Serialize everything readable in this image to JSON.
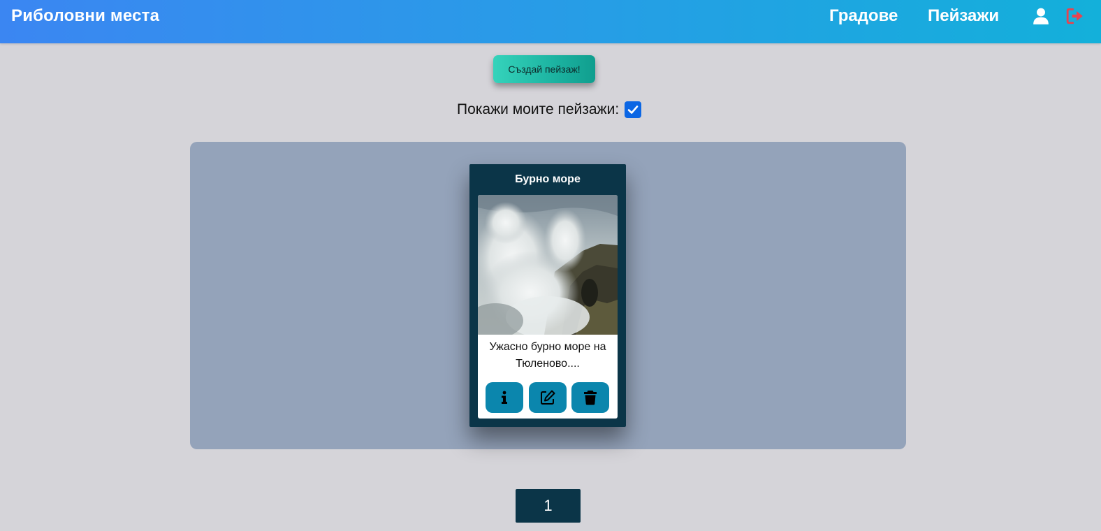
{
  "navbar": {
    "brand": "Риболовни места",
    "links": [
      {
        "label": "Градове"
      },
      {
        "label": "Пейзажи"
      }
    ],
    "icons": {
      "user": "user-icon",
      "logout": "logout-icon"
    },
    "colors": {
      "gradient_start": "#3b86f2",
      "gradient_end": "#13b0da",
      "logout_icon": "#e8434f"
    }
  },
  "actions": {
    "create_label": "Създай пейзаж!",
    "show_mine_label": "Покажи моите пейзажи:",
    "show_mine_checked": true
  },
  "cards": [
    {
      "title": "Бурно море",
      "image": "stormy sea waves crashing on rocky coast",
      "description": "Ужасно бурно море на Тюленово....",
      "buttons": [
        {
          "icon": "info-icon"
        },
        {
          "icon": "edit-icon"
        },
        {
          "icon": "trash-icon"
        }
      ]
    }
  ],
  "pagination": {
    "pages": [
      "1"
    ],
    "current": "1"
  }
}
